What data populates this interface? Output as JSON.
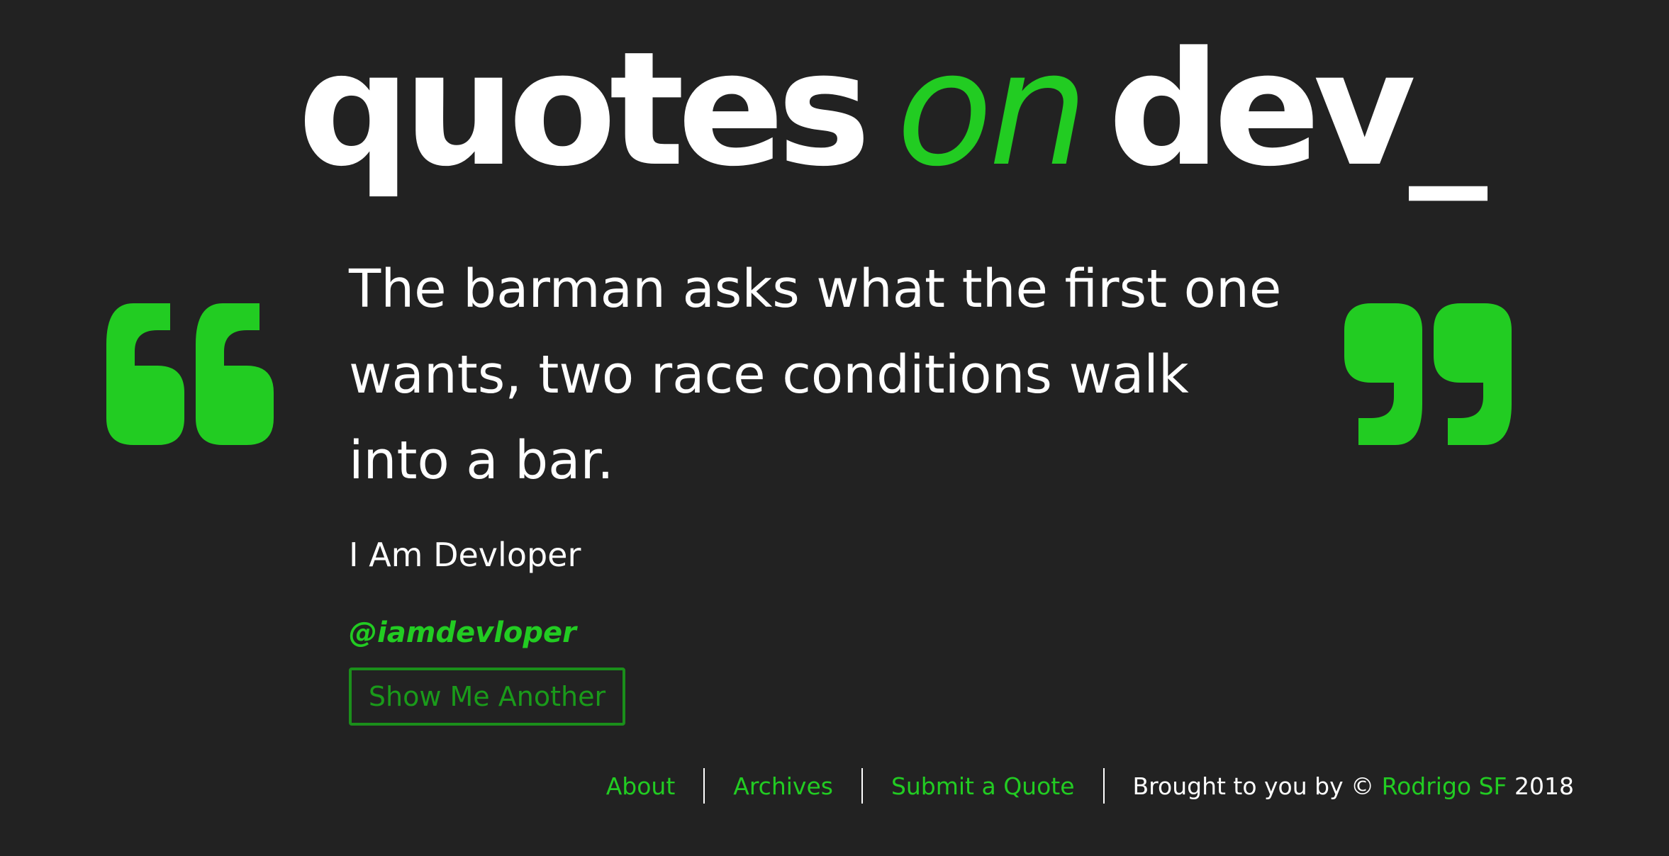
{
  "logo": {
    "word1": "quotes",
    "word2": "on",
    "word3": "dev_"
  },
  "icons": {
    "open_quote": "open-quote-icon",
    "close_quote": "close-quote-icon"
  },
  "quote": {
    "text": "The barman asks what the first one wants, two race conditions walk into a bar.",
    "author": "I Am Devloper",
    "handle": "@iamdevloper"
  },
  "actions": {
    "show_another_label": "Show Me Another"
  },
  "footer": {
    "nav": [
      "About",
      "Archives",
      "Submit a Quote"
    ],
    "credit_prefix": "Brought to you by ©",
    "credit_name": "Rodrigo SF",
    "credit_year": "2018"
  },
  "colors": {
    "background": "#222222",
    "accent": "#22cc22",
    "text": "#ffffff"
  }
}
